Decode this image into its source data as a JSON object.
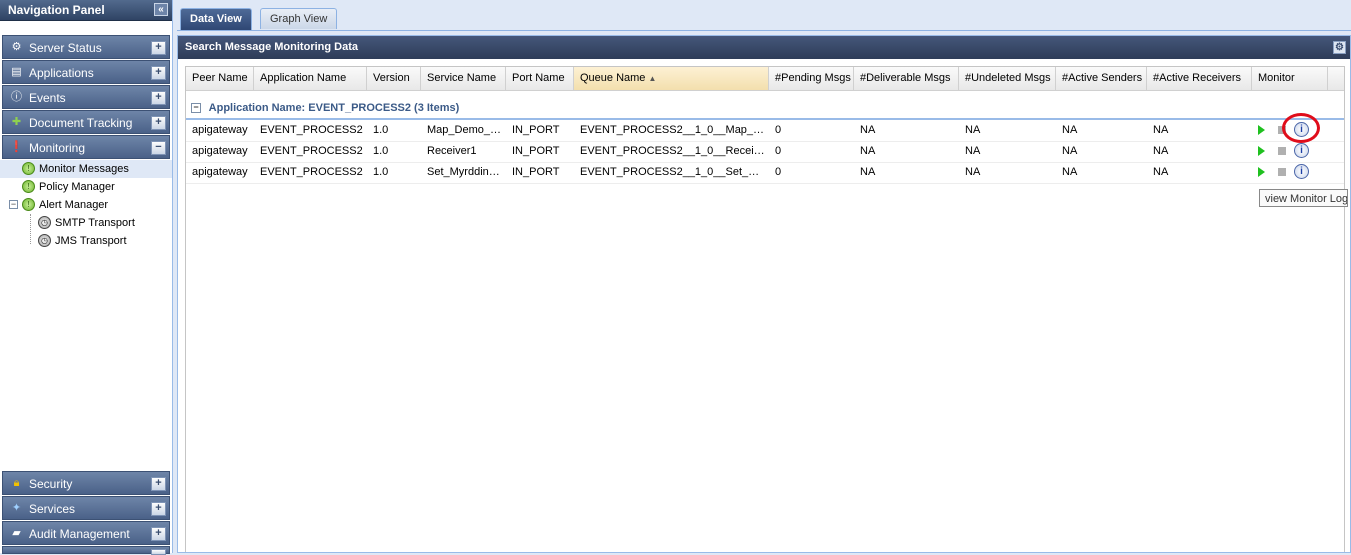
{
  "nav": {
    "title": "Navigation Panel",
    "sections_top": [
      {
        "label": "Server Status",
        "icon": "server-icon"
      },
      {
        "label": "Applications",
        "icon": "applications-icon"
      },
      {
        "label": "Events",
        "icon": "events-icon"
      },
      {
        "label": "Document Tracking",
        "icon": "puzzle-icon"
      },
      {
        "label": "Monitoring",
        "icon": "monitoring-icon",
        "expanded": true
      }
    ],
    "tree": [
      {
        "label": "Monitor Messages",
        "selected": true,
        "icon": "green-circle-icon"
      },
      {
        "label": "Policy Manager",
        "icon": "green-circle-icon"
      },
      {
        "label": "Alert Manager",
        "icon": "green-circle-icon",
        "expandable": true
      },
      {
        "label": "SMTP Transport",
        "icon": "clock-icon"
      },
      {
        "label": "JMS Transport",
        "icon": "clock-icon"
      }
    ],
    "sections_bottom": [
      {
        "label": "Security",
        "icon": "lock-icon"
      },
      {
        "label": "Services",
        "icon": "services-icon"
      },
      {
        "label": "Audit Management",
        "icon": "chat-icon"
      }
    ]
  },
  "tabs": [
    {
      "label": "Data View",
      "active": true
    },
    {
      "label": "Graph View",
      "active": false
    }
  ],
  "panel": {
    "title": "Search Message Monitoring Data"
  },
  "grid": {
    "columns": [
      "Peer Name",
      "Application Name",
      "Version",
      "Service Name",
      "Port Name",
      "Queue Name",
      "#Pending Msgs",
      "#Deliverable Msgs",
      "#Undeleted Msgs",
      "#Active Senders",
      "#Active Receivers",
      "Monitor"
    ],
    "sorted_column": "Queue Name",
    "group_label": "Application Name: EVENT_PROCESS2 (3 Items)",
    "rows": [
      [
        "apigateway",
        "EVENT_PROCESS2",
        "1.0",
        "Map_Demo_…",
        "IN_PORT",
        "EVENT_PROCESS2__1_0__Map_…",
        "0",
        "NA",
        "NA",
        "NA",
        "NA"
      ],
      [
        "apigateway",
        "EVENT_PROCESS2",
        "1.0",
        "Receiver1",
        "IN_PORT",
        "EVENT_PROCESS2__1_0__Recei…",
        "0",
        "NA",
        "NA",
        "NA",
        "NA"
      ],
      [
        "apigateway",
        "EVENT_PROCESS2",
        "1.0",
        "Set_Myrddin…",
        "IN_PORT",
        "EVENT_PROCESS2__1_0__Set_…",
        "0",
        "NA",
        "NA",
        "NA",
        "NA"
      ]
    ]
  },
  "tooltip": "view Monitor Logs",
  "colors": {
    "highlight_ring": "#e00d1a",
    "play": "#1fc01f"
  }
}
